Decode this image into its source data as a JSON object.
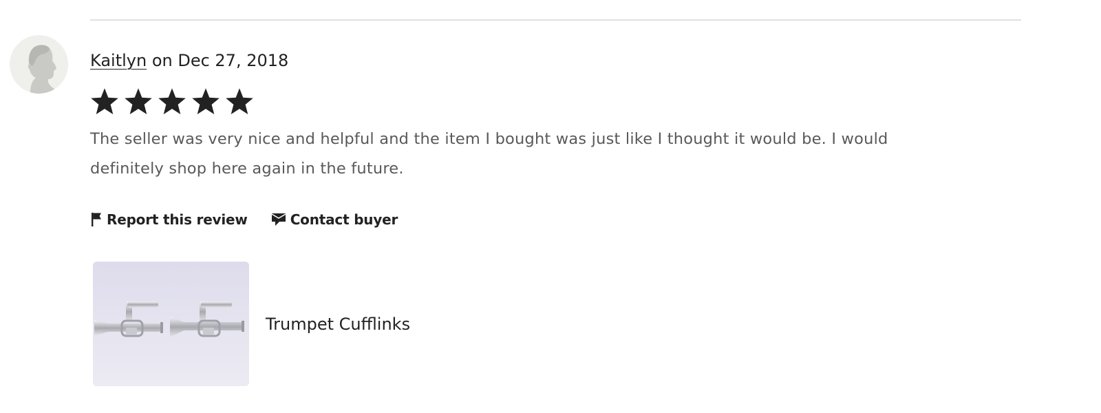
{
  "review": {
    "author": "Kaitlyn",
    "date_prefix": " on ",
    "date": "Dec 27, 2018",
    "rating": 5,
    "rating_max": 5,
    "text": "The seller was very nice and helpful and the item I bought was just like I thought it would be. I would definitely shop here again in the future."
  },
  "actions": {
    "report_label": "Report this review",
    "contact_label": "Contact buyer"
  },
  "product": {
    "name": "Trumpet Cufflinks"
  },
  "icons": {
    "avatar": "default-user-avatar-icon",
    "star": "star-icon",
    "report": "flag-icon",
    "contact": "message-icon"
  },
  "colors": {
    "text": "#222222",
    "review_text": "#595959",
    "divider": "#e1e1e1",
    "avatar_bg": "#efefec"
  }
}
